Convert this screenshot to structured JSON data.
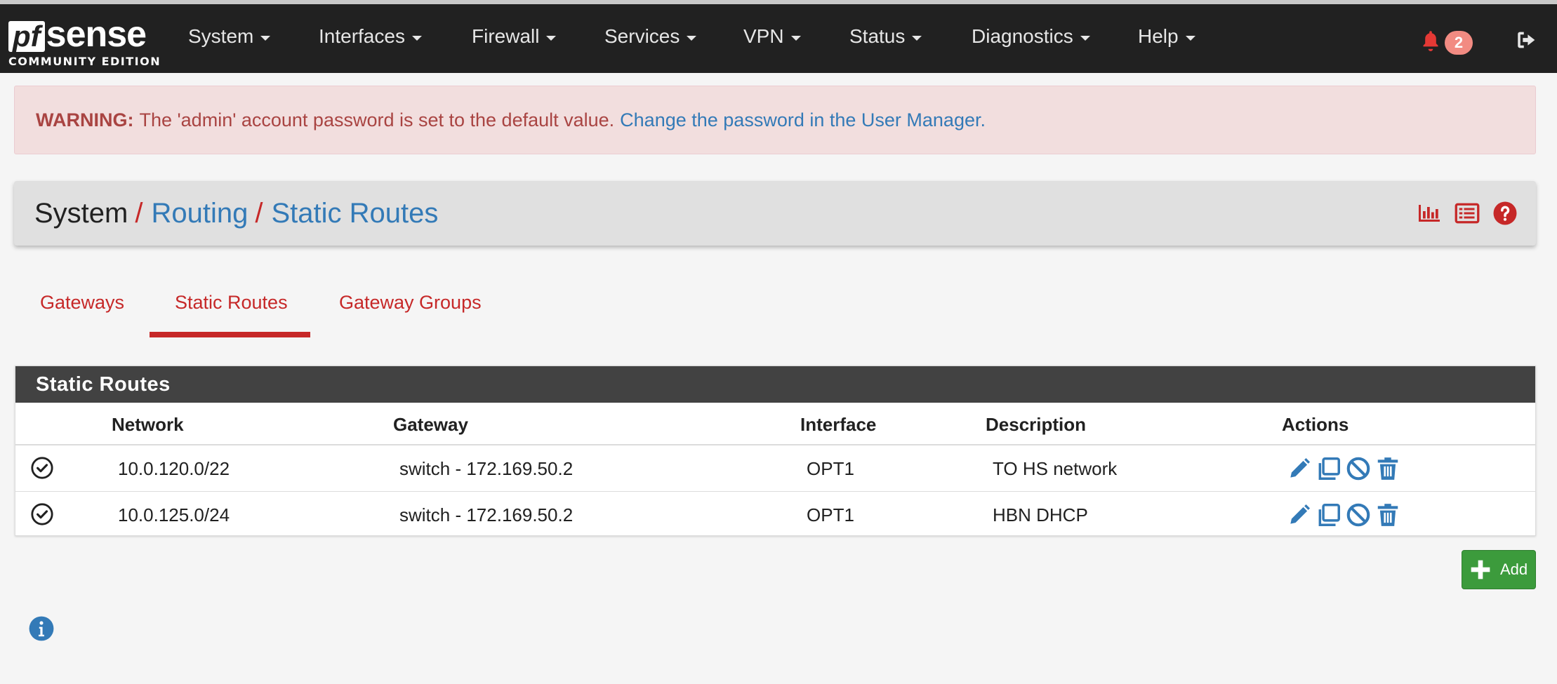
{
  "brand": {
    "logo_pf": "pf",
    "logo_sense": "sense",
    "edition": "COMMUNITY EDITION"
  },
  "nav": {
    "items": [
      {
        "label": "System"
      },
      {
        "label": "Interfaces"
      },
      {
        "label": "Firewall"
      },
      {
        "label": "Services"
      },
      {
        "label": "VPN"
      },
      {
        "label": "Status"
      },
      {
        "label": "Diagnostics"
      },
      {
        "label": "Help"
      }
    ],
    "notification_count": "2",
    "bell_icon": "bell-icon",
    "logout_icon": "logout-icon"
  },
  "alert": {
    "label": "WARNING:",
    "message": "The 'admin' account password is set to the default value.",
    "link": "Change the password in the User Manager."
  },
  "breadcrumb": {
    "root": "System",
    "sep": "/",
    "level2": "Routing",
    "current": "Static Routes",
    "icons": [
      "chart-icon",
      "list-icon",
      "help-icon"
    ]
  },
  "tabs": [
    {
      "label": "Gateways",
      "active": false
    },
    {
      "label": "Static Routes",
      "active": true
    },
    {
      "label": "Gateway Groups",
      "active": false
    }
  ],
  "panel": {
    "title": "Static Routes",
    "columns": [
      "Network",
      "Gateway",
      "Interface",
      "Description",
      "Actions"
    ],
    "rows": [
      {
        "network": "10.0.120.0/22",
        "gateway": "switch - 172.169.50.2",
        "interface": "OPT1",
        "description": "TO HS network"
      },
      {
        "network": "10.0.125.0/24",
        "gateway": "switch - 172.169.50.2",
        "interface": "OPT1",
        "description": "HBN DHCP"
      }
    ],
    "action_icons": [
      "pencil-icon",
      "copy-icon",
      "disable-icon",
      "trash-icon"
    ]
  },
  "add_button": {
    "label": "Add"
  },
  "colors": {
    "nav_bg": "#212121",
    "accent_red": "#c62828",
    "link_blue": "#337ab7",
    "panel_header": "#424242",
    "add_green": "#3c9b3c",
    "alert_bg": "#f2dede",
    "alert_text": "#a94442"
  }
}
